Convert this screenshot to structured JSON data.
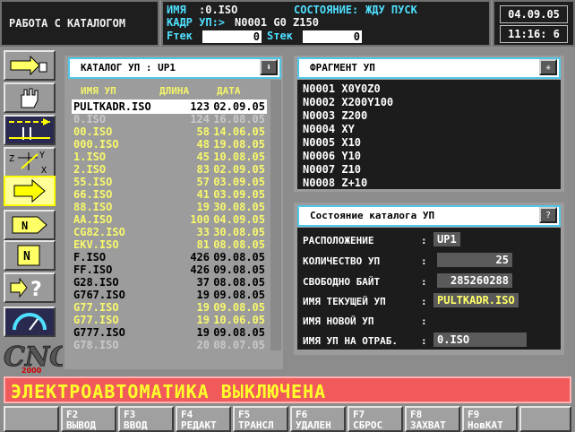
{
  "header": {
    "mode_title": "РАБОТА С КАТАЛОГОМ",
    "name_label": "ИМЯ",
    "name_value": ":0.ISO",
    "status_label": "СОСТОЯНИЕ:",
    "status_value": "ЖДУ ПУСК",
    "frame_label": "КАДР УП:>",
    "frame_value": "N0001 G0 Z150",
    "ftek_label": "Fтек",
    "ftek_value": "0",
    "stek_label": "Sтек",
    "stek_value": "0",
    "date": "04.09.05",
    "time": "11:16: 6"
  },
  "toolbar": {
    "icons": [
      "load-arrow-icon",
      "hand-icon",
      "feed-arrows-icon",
      "axes-icon",
      "arrow-right-icon",
      "n-arrow-icon",
      "n-block-icon",
      "help-icon",
      "gauge-icon"
    ]
  },
  "catalog": {
    "title": "КАТАЛОГ УП : UP1",
    "col_name": "ИМЯ УП",
    "col_len": "ДЛИНА",
    "col_date": "ДАТА",
    "rows": [
      {
        "name": "PULTKADR.ISO",
        "len": "123",
        "date": "02.09.05",
        "style": "sel"
      },
      {
        "name": "0.ISO",
        "len": "124",
        "date": "16.08.05",
        "style": "grey"
      },
      {
        "name": "00.ISO",
        "len": "58",
        "date": "14.06.05",
        "style": "yellow"
      },
      {
        "name": "000.ISO",
        "len": "48",
        "date": "19.08.05",
        "style": "yellow"
      },
      {
        "name": "1.ISO",
        "len": "45",
        "date": "10.08.05",
        "style": "yellow"
      },
      {
        "name": "2.ISO",
        "len": "83",
        "date": "02.09.05",
        "style": "yellow"
      },
      {
        "name": "55.ISO",
        "len": "57",
        "date": "03.09.05",
        "style": "yellow"
      },
      {
        "name": "66.ISO",
        "len": "41",
        "date": "03.09.05",
        "style": "yellow"
      },
      {
        "name": "88.ISO",
        "len": "19",
        "date": "30.08.05",
        "style": "yellow"
      },
      {
        "name": "AA.ISO",
        "len": "100",
        "date": "04.09.05",
        "style": "yellow"
      },
      {
        "name": "CG82.ISO",
        "len": "33",
        "date": "30.08.05",
        "style": "yellow"
      },
      {
        "name": "EKV.ISO",
        "len": "81",
        "date": "08.08.05",
        "style": "yellow"
      },
      {
        "name": "F.ISO",
        "len": "426",
        "date": "09.08.05",
        "style": "black"
      },
      {
        "name": "FF.ISO",
        "len": "426",
        "date": "09.08.05",
        "style": "black"
      },
      {
        "name": "G28.ISO",
        "len": "37",
        "date": "08.08.05",
        "style": "black"
      },
      {
        "name": "G767.ISO",
        "len": "19",
        "date": "09.08.05",
        "style": "black"
      },
      {
        "name": "G77.ISO",
        "len": "19",
        "date": "09.08.05",
        "style": "yellow"
      },
      {
        "name": "G77.ISO",
        "len": "19",
        "date": "10.06.05",
        "style": "yellow"
      },
      {
        "name": "G777.ISO",
        "len": "19",
        "date": "09.08.05",
        "style": "black"
      },
      {
        "name": "G78.ISO",
        "len": "20",
        "date": "08.07.05",
        "style": "grey"
      }
    ]
  },
  "fragment": {
    "title": "ФРАГМЕНТ УП",
    "lines": [
      "N0001 X0Y0Z0",
      "N0002 X200Y100",
      "N0003 Z200",
      "N0004 XY",
      "N0005 X10",
      "N0006 Y10",
      "N0007 Z10",
      "N0008 Z+10"
    ]
  },
  "catalog_state": {
    "title": "Состояние каталога УП",
    "location_label": "РАСПОЛОЖЕНИЕ",
    "location_value": "UP1",
    "count_label": "КОЛИЧЕСТВО УП",
    "count_value": "25",
    "free_label": "СВОБОДНО БАЙТ",
    "free_value": "285260288",
    "current_label": "ИМЯ ТЕКУЩЕЙ УП",
    "current_value": "PULTKADR.ISO",
    "new_label": "ИМЯ НОВОЙ УП",
    "new_value": "",
    "proc_label": "ИМЯ УП НА ОТРАБ.",
    "proc_value": "0.ISO",
    "colon": ":"
  },
  "message": "ЭЛЕКТРОАВТОМАТИКА ВЫКЛЮЧЕНА",
  "fkeys": [
    {
      "key": "",
      "label": ""
    },
    {
      "key": "F2",
      "label": "ВЫВОД"
    },
    {
      "key": "F3",
      "label": "ВВОД"
    },
    {
      "key": "F4",
      "label": "РЕДАКТ"
    },
    {
      "key": "F5",
      "label": "ТРАНСЛ"
    },
    {
      "key": "F6",
      "label": "УДАЛЕН"
    },
    {
      "key": "F7",
      "label": "СБРОС"
    },
    {
      "key": "F8",
      "label": "ЗАХВАТ"
    },
    {
      "key": "F9",
      "label": "НовКАТ"
    },
    {
      "key": "",
      "label": ""
    }
  ],
  "logo_text": "CNC",
  "colors": {
    "accent": "#4fc7e8",
    "message_bg": "#f05a5a",
    "message_text": "#ffff2a"
  }
}
